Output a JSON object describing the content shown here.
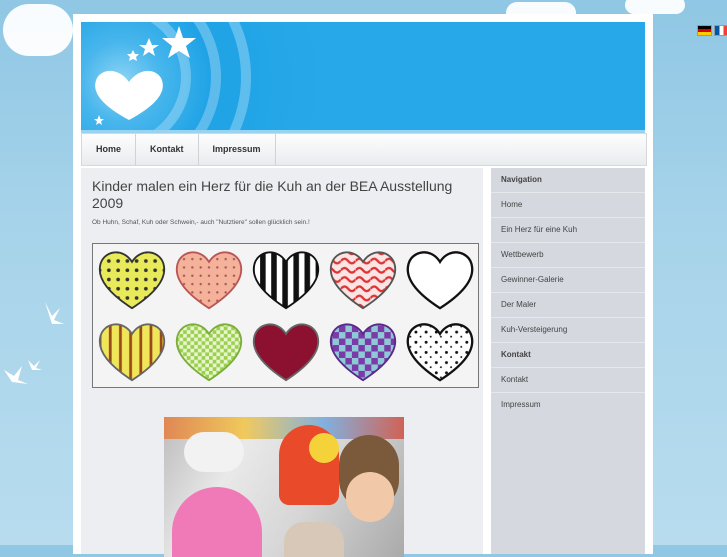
{
  "nav": {
    "items": [
      "Home",
      "Kontakt",
      "Impressum"
    ]
  },
  "article": {
    "title": "Kinder malen ein Herz für die Kuh an der BEA Ausstellung 2009",
    "subtitle": "Ob Huhn, Schaf, Kuh oder Schwein,- auch \"Nutztiere\" sollen glücklich sein.!"
  },
  "sidebar": {
    "nav_heading": "Navigation",
    "nav_items": [
      "Home",
      "Ein Herz für eine Kuh",
      "Wettbewerb",
      "Gewinner-Galerie",
      "Der Maler",
      "Kuh-Versteigerung"
    ],
    "contact_heading": "Kontakt",
    "contact_items": [
      "Kontakt",
      "Impressum"
    ]
  },
  "languages": [
    "de-flag-icon",
    "fr-flag-icon"
  ],
  "colors": {
    "banner": "#27a8e8",
    "nav_bg": "#eef0f2",
    "sidebar_bg": "#d5d8de",
    "content_bg": "#eceef1"
  }
}
